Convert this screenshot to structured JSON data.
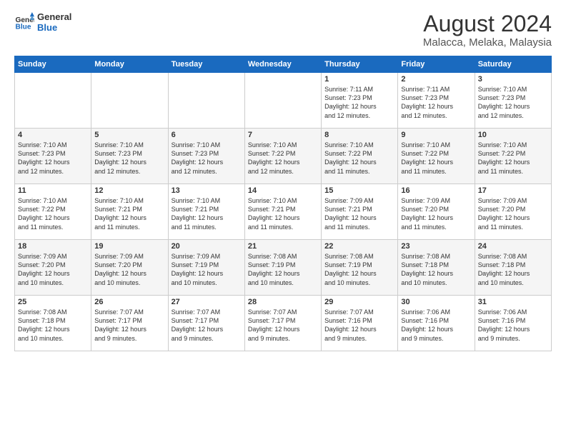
{
  "header": {
    "logo_line1": "General",
    "logo_line2": "Blue",
    "title": "August 2024",
    "subtitle": "Malacca, Melaka, Malaysia"
  },
  "weekdays": [
    "Sunday",
    "Monday",
    "Tuesday",
    "Wednesday",
    "Thursday",
    "Friday",
    "Saturday"
  ],
  "weeks": [
    [
      {
        "day": "",
        "info": ""
      },
      {
        "day": "",
        "info": ""
      },
      {
        "day": "",
        "info": ""
      },
      {
        "day": "",
        "info": ""
      },
      {
        "day": "1",
        "info": "Sunrise: 7:11 AM\nSunset: 7:23 PM\nDaylight: 12 hours\nand 12 minutes."
      },
      {
        "day": "2",
        "info": "Sunrise: 7:11 AM\nSunset: 7:23 PM\nDaylight: 12 hours\nand 12 minutes."
      },
      {
        "day": "3",
        "info": "Sunrise: 7:10 AM\nSunset: 7:23 PM\nDaylight: 12 hours\nand 12 minutes."
      }
    ],
    [
      {
        "day": "4",
        "info": "Sunrise: 7:10 AM\nSunset: 7:23 PM\nDaylight: 12 hours\nand 12 minutes."
      },
      {
        "day": "5",
        "info": "Sunrise: 7:10 AM\nSunset: 7:23 PM\nDaylight: 12 hours\nand 12 minutes."
      },
      {
        "day": "6",
        "info": "Sunrise: 7:10 AM\nSunset: 7:23 PM\nDaylight: 12 hours\nand 12 minutes."
      },
      {
        "day": "7",
        "info": "Sunrise: 7:10 AM\nSunset: 7:22 PM\nDaylight: 12 hours\nand 12 minutes."
      },
      {
        "day": "8",
        "info": "Sunrise: 7:10 AM\nSunset: 7:22 PM\nDaylight: 12 hours\nand 11 minutes."
      },
      {
        "day": "9",
        "info": "Sunrise: 7:10 AM\nSunset: 7:22 PM\nDaylight: 12 hours\nand 11 minutes."
      },
      {
        "day": "10",
        "info": "Sunrise: 7:10 AM\nSunset: 7:22 PM\nDaylight: 12 hours\nand 11 minutes."
      }
    ],
    [
      {
        "day": "11",
        "info": "Sunrise: 7:10 AM\nSunset: 7:22 PM\nDaylight: 12 hours\nand 11 minutes."
      },
      {
        "day": "12",
        "info": "Sunrise: 7:10 AM\nSunset: 7:21 PM\nDaylight: 12 hours\nand 11 minutes."
      },
      {
        "day": "13",
        "info": "Sunrise: 7:10 AM\nSunset: 7:21 PM\nDaylight: 12 hours\nand 11 minutes."
      },
      {
        "day": "14",
        "info": "Sunrise: 7:10 AM\nSunset: 7:21 PM\nDaylight: 12 hours\nand 11 minutes."
      },
      {
        "day": "15",
        "info": "Sunrise: 7:09 AM\nSunset: 7:21 PM\nDaylight: 12 hours\nand 11 minutes."
      },
      {
        "day": "16",
        "info": "Sunrise: 7:09 AM\nSunset: 7:20 PM\nDaylight: 12 hours\nand 11 minutes."
      },
      {
        "day": "17",
        "info": "Sunrise: 7:09 AM\nSunset: 7:20 PM\nDaylight: 12 hours\nand 11 minutes."
      }
    ],
    [
      {
        "day": "18",
        "info": "Sunrise: 7:09 AM\nSunset: 7:20 PM\nDaylight: 12 hours\nand 10 minutes."
      },
      {
        "day": "19",
        "info": "Sunrise: 7:09 AM\nSunset: 7:20 PM\nDaylight: 12 hours\nand 10 minutes."
      },
      {
        "day": "20",
        "info": "Sunrise: 7:09 AM\nSunset: 7:19 PM\nDaylight: 12 hours\nand 10 minutes."
      },
      {
        "day": "21",
        "info": "Sunrise: 7:08 AM\nSunset: 7:19 PM\nDaylight: 12 hours\nand 10 minutes."
      },
      {
        "day": "22",
        "info": "Sunrise: 7:08 AM\nSunset: 7:19 PM\nDaylight: 12 hours\nand 10 minutes."
      },
      {
        "day": "23",
        "info": "Sunrise: 7:08 AM\nSunset: 7:18 PM\nDaylight: 12 hours\nand 10 minutes."
      },
      {
        "day": "24",
        "info": "Sunrise: 7:08 AM\nSunset: 7:18 PM\nDaylight: 12 hours\nand 10 minutes."
      }
    ],
    [
      {
        "day": "25",
        "info": "Sunrise: 7:08 AM\nSunset: 7:18 PM\nDaylight: 12 hours\nand 10 minutes."
      },
      {
        "day": "26",
        "info": "Sunrise: 7:07 AM\nSunset: 7:17 PM\nDaylight: 12 hours\nand 9 minutes."
      },
      {
        "day": "27",
        "info": "Sunrise: 7:07 AM\nSunset: 7:17 PM\nDaylight: 12 hours\nand 9 minutes."
      },
      {
        "day": "28",
        "info": "Sunrise: 7:07 AM\nSunset: 7:17 PM\nDaylight: 12 hours\nand 9 minutes."
      },
      {
        "day": "29",
        "info": "Sunrise: 7:07 AM\nSunset: 7:16 PM\nDaylight: 12 hours\nand 9 minutes."
      },
      {
        "day": "30",
        "info": "Sunrise: 7:06 AM\nSunset: 7:16 PM\nDaylight: 12 hours\nand 9 minutes."
      },
      {
        "day": "31",
        "info": "Sunrise: 7:06 AM\nSunset: 7:16 PM\nDaylight: 12 hours\nand 9 minutes."
      }
    ]
  ]
}
